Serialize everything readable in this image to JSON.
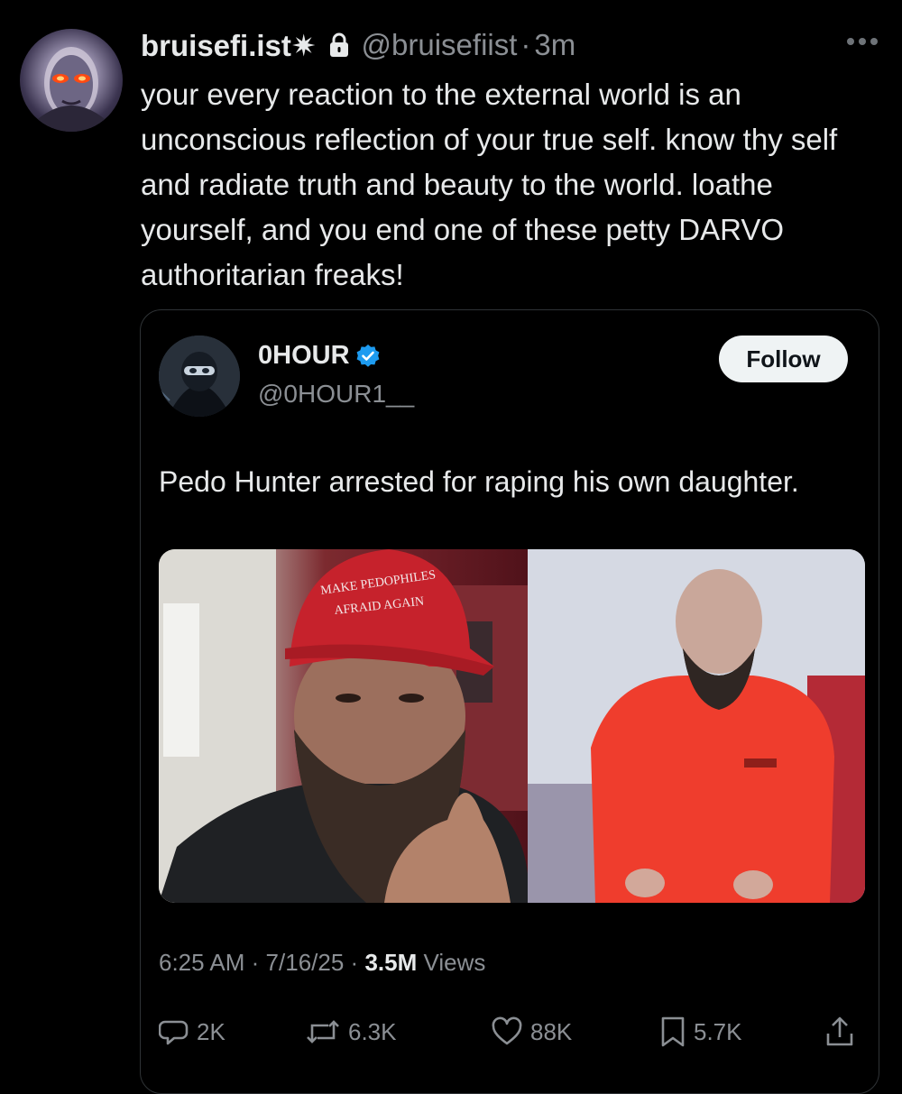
{
  "tweet": {
    "display_name": "bruisefi.ist✷",
    "handle": "@bruisefiist",
    "separator": "·",
    "time": "3m",
    "text": "your every reaction to the external world is an unconscious reflection of your true self. know thy self and radiate truth and beauty to the world. loathe yourself, and you end one of these petty DARVO authoritarian freaks!"
  },
  "quoted": {
    "display_name": "0HOUR",
    "handle": "@0HOUR1__",
    "follow_label": "Follow",
    "text": "Pedo Hunter arrested for raping his own daughter.",
    "hat_text_line1": "MAKE PEDOPHILES",
    "hat_text_line2": "AFRAID AGAIN",
    "time": "6:25 AM",
    "date": "7/16/25",
    "views_count": "3.5M",
    "views_label": "Views",
    "sep": "·"
  },
  "actions": {
    "replies": "2K",
    "reposts": "6.3K",
    "likes": "88K",
    "bookmarks": "5.7K"
  },
  "colors": {
    "background": "#000000",
    "text": "#e7e9ea",
    "muted": "#8b8f94",
    "verified": "#1d9bf0"
  }
}
